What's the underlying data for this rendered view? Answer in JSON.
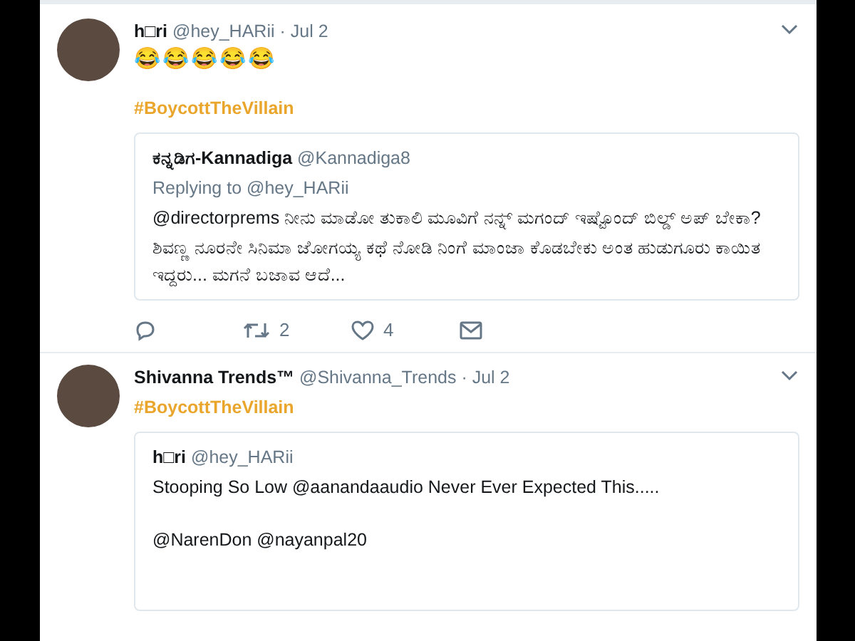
{
  "tweets": [
    {
      "name": "h□ri",
      "handle": "@hey_HARii",
      "date": "· Jul 2",
      "text": "😂😂😂😂😂",
      "hashtag": "#BoycottTheVillain",
      "quote": {
        "name": "ಕನ್ನಡಿಗ-Kannadiga",
        "handle": "@Kannadiga8",
        "replying_to": "Replying to @hey_HARii",
        "lines": [
          "@directorprems ನೀನು ಮಾಡೋ ತುಕಾಲಿ ಮೂವಿಗೆ ನನ್ನ್ ಮಗಂದ್ ಇಷ್ಟೊಂದ್ ಬಿಲ್ಡ್ ಅಪ್ ಬೇಕಾ?",
          "ಶಿವಣ್ಣ ನೂರನೇ ಸಿನಿಮಾ ಜೋಗಯ್ಯ ಕಥೆ ನೋಡಿ ನಿಂಗೆ ಮಾಂಜಾ ಕೊಡಬೇಕು ಅಂತ ಹುಡುಗೂರು ಕಾಯಿತ ಇದ್ದರು... ಮಗನೆ ಬಜಾವ ಆದೆ..."
        ]
      },
      "actions": [
        {
          "kind": "reply"
        },
        {
          "kind": "retweet",
          "count": "2"
        },
        {
          "kind": "like",
          "count": "4"
        },
        {
          "kind": "message"
        }
      ]
    },
    {
      "name": "Shivanna Trends™",
      "handle": "@Shivanna_Trends",
      "date": "· Jul 2",
      "hashtag": "#BoycottTheVillain",
      "quote": {
        "name": "h□ri",
        "handle": "@hey_HARii",
        "paragraphs": [
          "Stooping So Low @aanandaaudio Never Ever Expected This.....",
          "@NarenDon @nayanpal20"
        ]
      }
    }
  ]
}
